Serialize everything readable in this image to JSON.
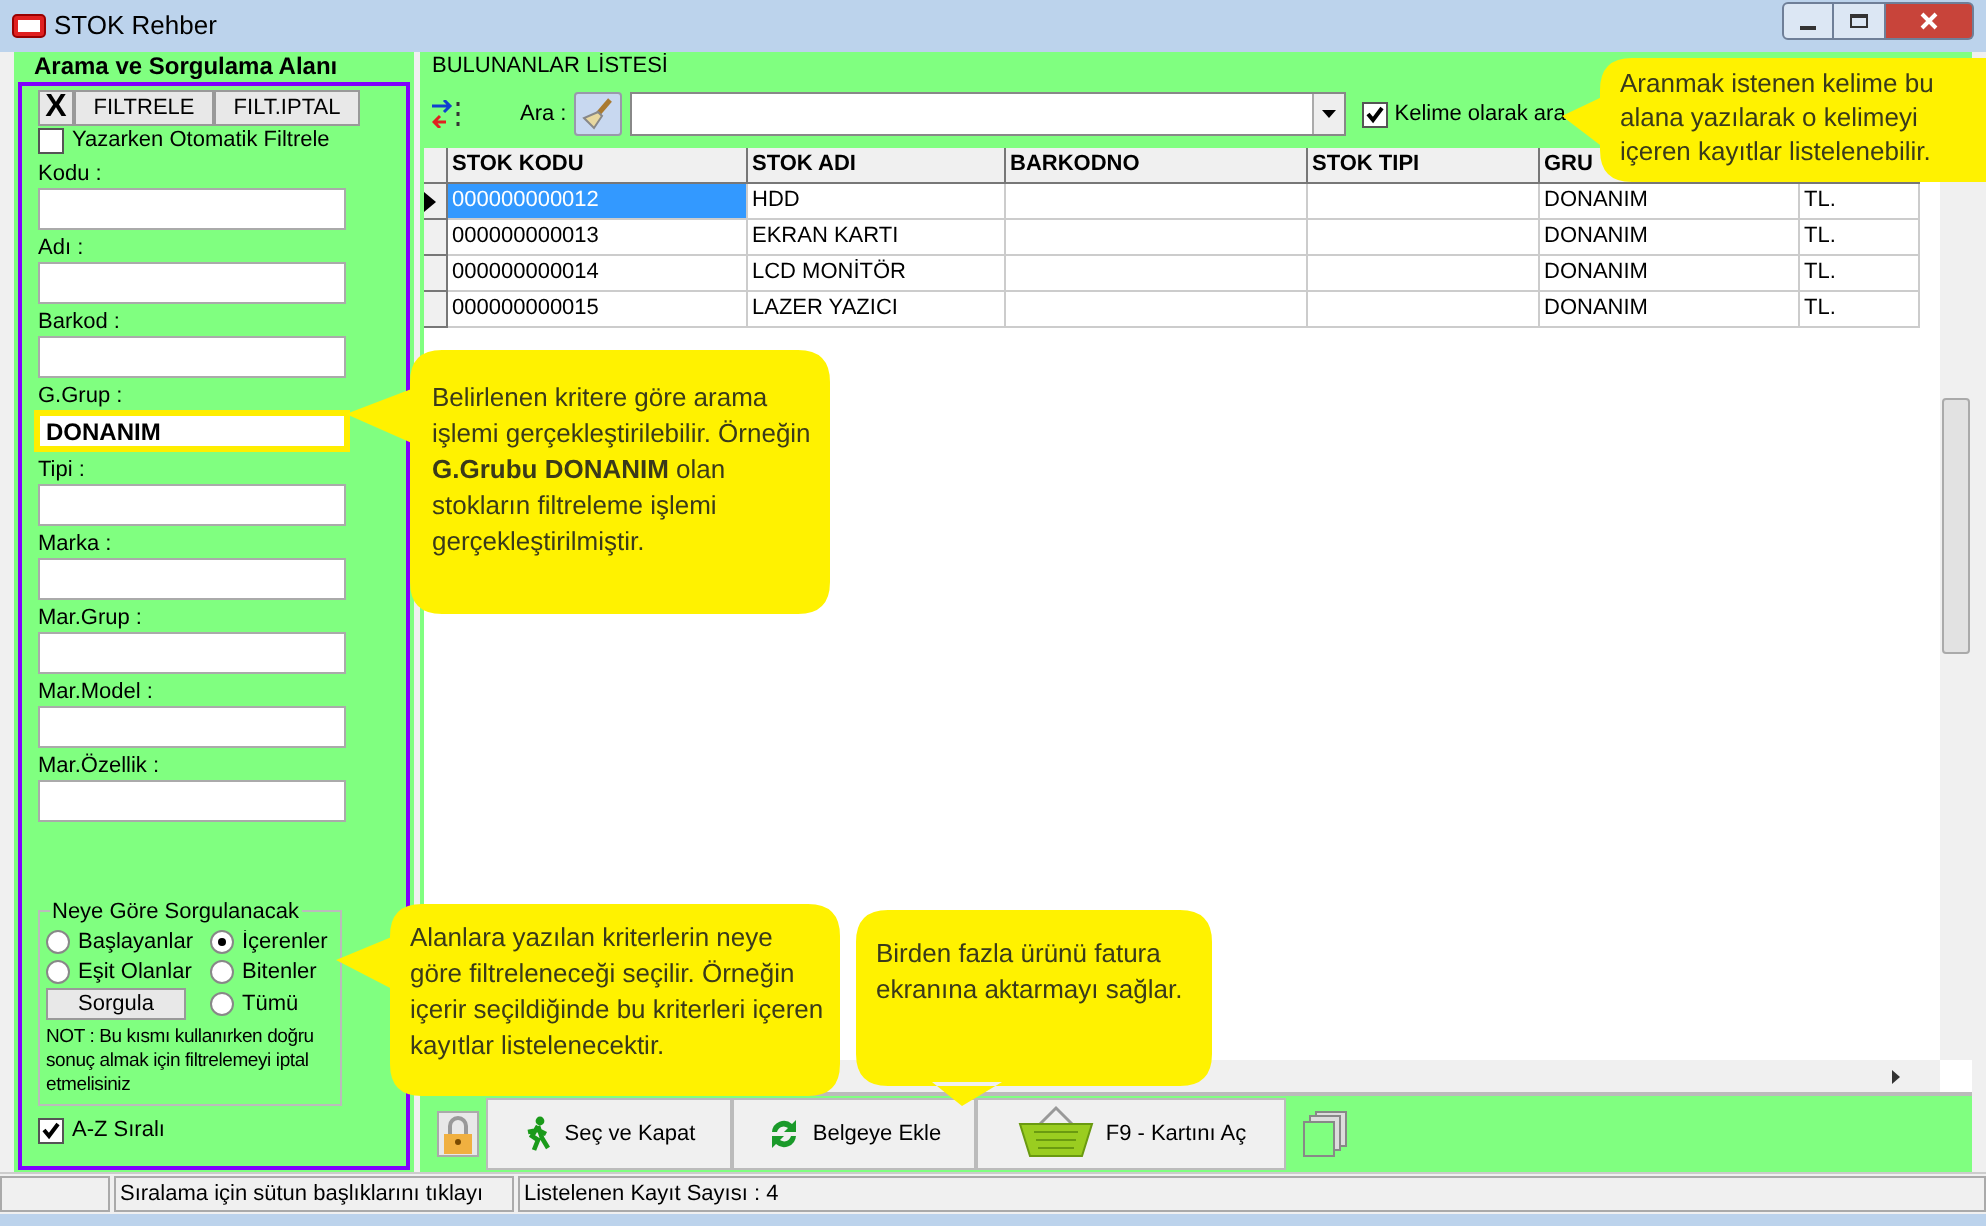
{
  "window": {
    "title": "STOK Rehber"
  },
  "left_panel": {
    "title": "Arama ve Sorgulama Alanı",
    "buttons": [
      {
        "label": "X",
        "kind": "clear"
      },
      {
        "label": "FILTRELE",
        "kind": "text"
      },
      {
        "label": "FILT.IPTAL",
        "kind": "text"
      }
    ],
    "auto_filter": {
      "label": "Yazarken Otomatik Filtrele",
      "checked": false
    },
    "fields": [
      {
        "label": "Kodu :",
        "highlighted": false
      },
      {
        "label": "Adı :",
        "highlighted": false
      },
      {
        "label": "Barkod :",
        "highlighted": false
      },
      {
        "label": "G.Grup :",
        "value": "DONANIM",
        "highlighted": true
      },
      {
        "label": "Tipi :",
        "highlighted": false
      },
      {
        "label": "Marka :",
        "highlighted": false
      },
      {
        "label": "Mar.Grup :",
        "highlighted": false
      },
      {
        "label": "Mar.Model :",
        "highlighted": false
      },
      {
        "label": "Mar.Özellik :",
        "highlighted": false
      }
    ],
    "query_group": {
      "title": "Neye Göre Sorgulanacak",
      "options": [
        {
          "label": "Başlayanlar",
          "selected": false
        },
        {
          "label": "İçerenler",
          "selected": true
        },
        {
          "label": "Eşit Olanlar",
          "selected": false
        },
        {
          "label": "Bitenler",
          "selected": false
        },
        {
          "label": "Tümü",
          "selected": false
        }
      ],
      "button": "Sorgula",
      "note": "NOT : Bu kısmı kullanırken doğru sonuç almak için filtrelemeyi iptal etmelisiniz"
    },
    "sort_checkbox": {
      "label": "A-Z Sıralı",
      "checked": true
    }
  },
  "list": {
    "title": "BULUNANLAR LİSTESİ",
    "search": {
      "label": "Ara :"
    },
    "word_checkbox": {
      "label": "Kelime olarak ara",
      "checked": true
    },
    "table": {
      "columns": [
        "STOK KODU",
        "STOK ADI",
        "BARKODNO",
        "STOK TIPI",
        "GRU"
      ],
      "rows": [
        {
          "cells": [
            "000000000012",
            "HDD",
            "",
            "",
            "DONANIM",
            "TL."
          ],
          "selected": true
        },
        {
          "cells": [
            "000000000013",
            "EKRAN KARTI",
            "",
            "",
            "DONANIM",
            "TL."
          ],
          "selected": false
        },
        {
          "cells": [
            "000000000014",
            "LCD MONİTÖR",
            "",
            "",
            "DONANIM",
            "TL."
          ],
          "selected": false
        },
        {
          "cells": [
            "000000000015",
            "LAZER YAZICI",
            "",
            "",
            "DONANIM",
            "TL."
          ],
          "selected": false
        }
      ]
    }
  },
  "bottom_buttons": [
    {
      "kind": "lock"
    },
    {
      "label": "Seç ve Kapat",
      "kind": "walk"
    },
    {
      "label": "Belgeye Ekle",
      "kind": "refresh"
    },
    {
      "label": "F9 - Kartını Aç",
      "kind": "basket"
    },
    {
      "kind": "windows"
    }
  ],
  "status_bar": [
    "Sıralama için sütun başlıklarını tıklayı",
    "Listelenen Kayıt Sayısı : 4"
  ],
  "callouts": [
    {
      "text": "Aranmak istenen kelime bu alana yazılarak o kelimeyi içeren kayıtlar listelenebilir."
    },
    {
      "text": "Belirlenen kritere göre arama işlemi gerçekleştirilebilir. Örneğin **G.Grubu DONANIM** olan stokların filtreleme işlemi gerçekleştirilmiştir."
    },
    {
      "text": "Alanlara yazılan kriterlerin neye göre filtreleneceği seçilir. Örneğin içerir seçildiğinde bu kriterleri içeren kayıtlar listelenecektir."
    },
    {
      "text": "Birden fazla ürünü fatura ekranına aktarmayı sağlar."
    }
  ]
}
